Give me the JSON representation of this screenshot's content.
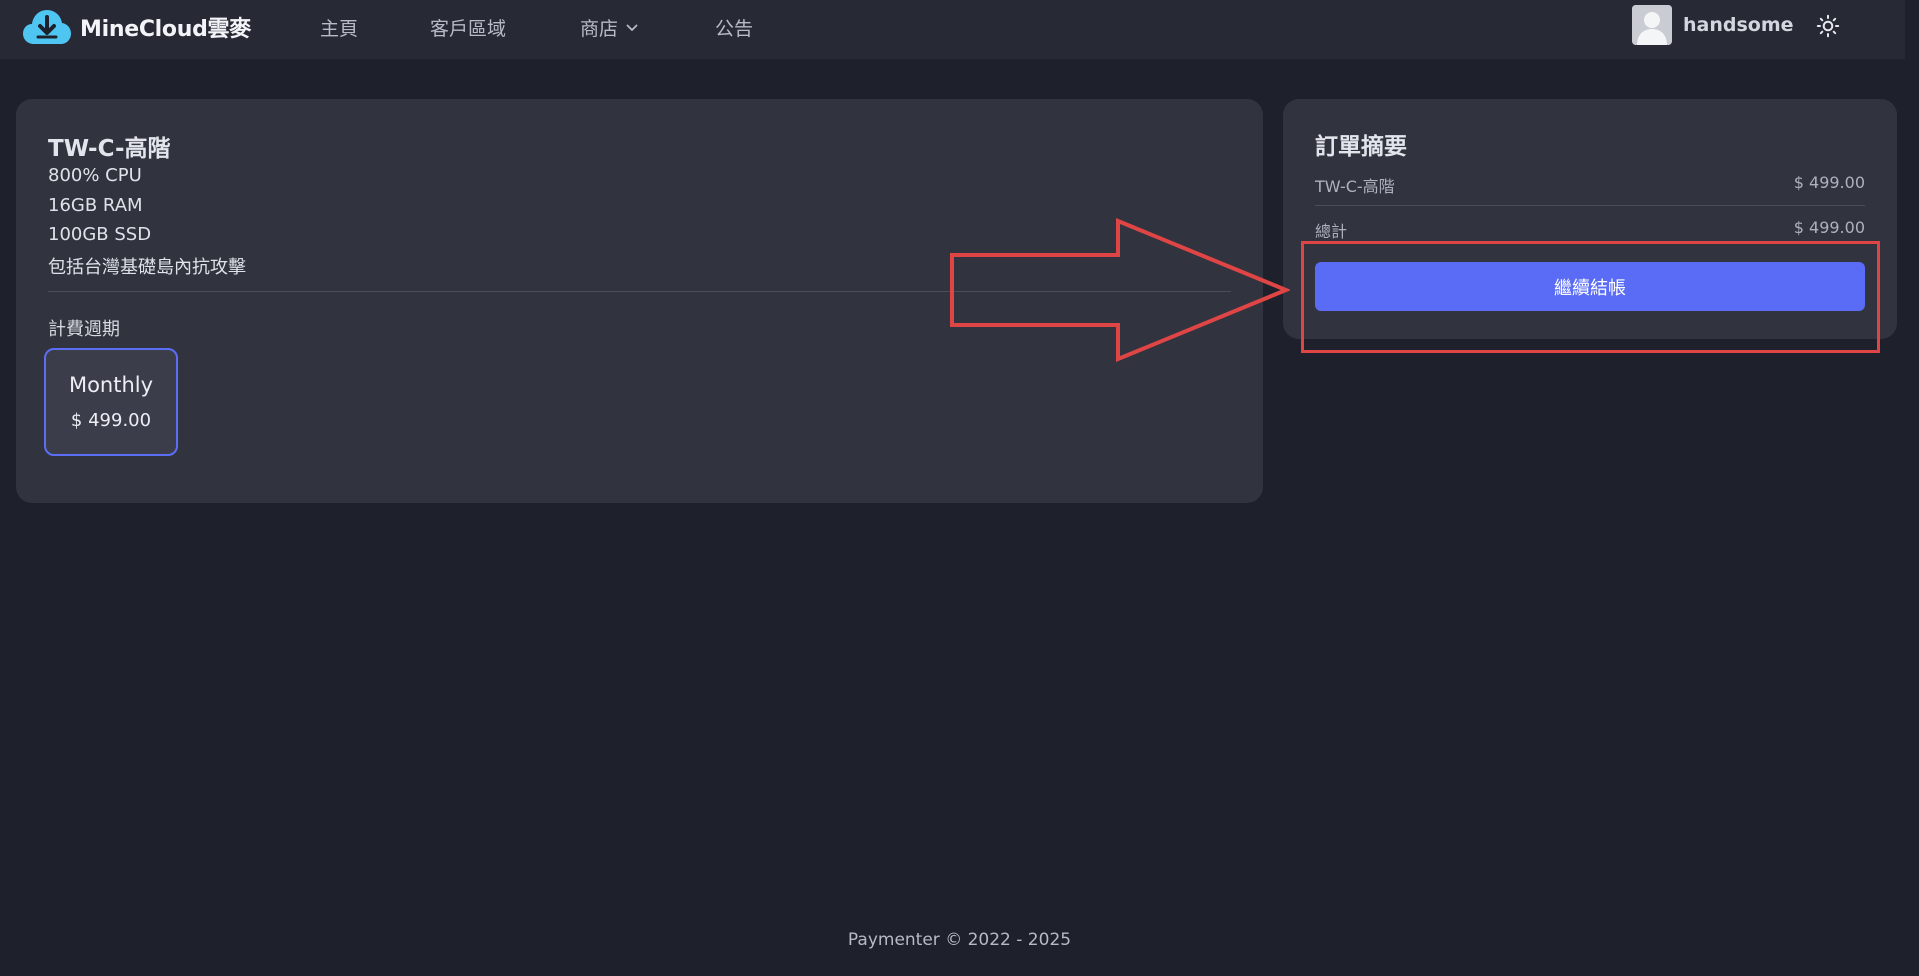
{
  "brand": {
    "name": "MineCloud雲麥",
    "logo_color": "#4fc6f1"
  },
  "nav": {
    "home": "主頁",
    "client_area": "客戶區域",
    "store": "商店",
    "announcements": "公告"
  },
  "user": {
    "name": "handsome"
  },
  "product": {
    "title": "TW-C-高階",
    "specs": [
      "800% CPU",
      "16GB RAM",
      "100GB SSD",
      "包括台灣基礎島內抗攻擊"
    ],
    "billing_label": "計費週期",
    "plan": {
      "name": "Monthly",
      "price": "$ 499.00"
    }
  },
  "summary": {
    "title": "訂單摘要",
    "item_name": "TW-C-高階",
    "item_price": "$ 499.00",
    "total_label": "總計",
    "total_price": "$ 499.00",
    "checkout_label": "繼續結帳"
  },
  "footer": {
    "text": "Paymenter © 2022 - 2025"
  },
  "colors": {
    "background": "#1e202b",
    "navbar": "#272935",
    "card": "#31333f",
    "accent": "#5a6cf5",
    "annotation": "#df4545"
  }
}
